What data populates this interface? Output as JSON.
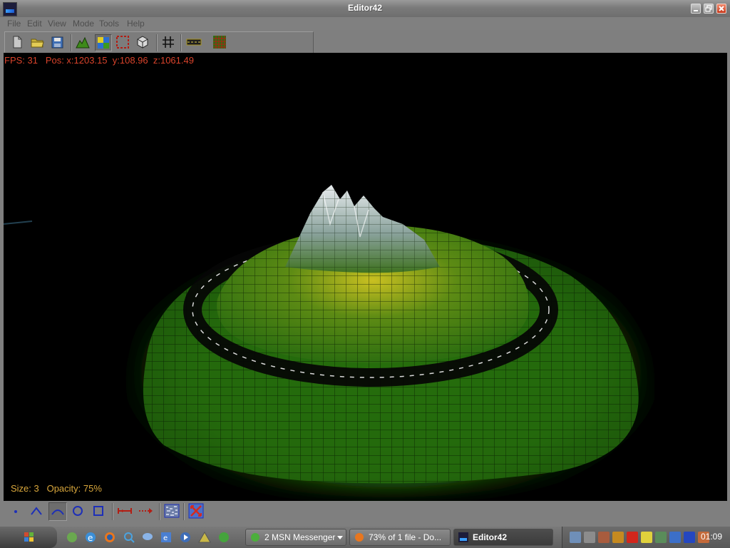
{
  "window": {
    "title": "Editor42",
    "icon": "editor42-app-icon"
  },
  "menu": [
    "File",
    "Edit",
    "View",
    "Mode",
    "Tools",
    "Help"
  ],
  "toolbar": {
    "buttons": [
      {
        "name": "new-file-icon"
      },
      {
        "name": "open-folder-icon"
      },
      {
        "name": "save-disk-icon"
      },
      {
        "name": "terrain-heightmap-icon"
      },
      {
        "name": "texture-paint-icon"
      },
      {
        "name": "selection-area-icon"
      },
      {
        "name": "cube-object-icon"
      },
      {
        "name": "grid-toggle-icon"
      },
      {
        "name": "road-tool-icon"
      },
      {
        "name": "tile-grid-icon"
      }
    ]
  },
  "viewport": {
    "fps_label": "FPS: 31",
    "pos_label": "Pos: x:1203.15  y:108.96  z:1061.49",
    "size_label": "Size: 3",
    "opacity_label": "Opacity: 75%"
  },
  "bottom_toolbar": {
    "buttons": [
      {
        "name": "point-brush-icon"
      },
      {
        "name": "peak-brush-icon"
      },
      {
        "name": "smooth-brush-icon"
      },
      {
        "name": "circle-brush-icon"
      },
      {
        "name": "square-brush-icon"
      },
      {
        "name": "measure-distance-icon"
      },
      {
        "name": "dotted-arrow-icon"
      },
      {
        "name": "noise-texture-icon"
      },
      {
        "name": "fit-view-icon"
      }
    ]
  },
  "taskbar": {
    "tasks": [
      {
        "label": "2 MSN Messenger",
        "icon": "msn-messenger-icon",
        "active": false
      },
      {
        "label": "73% of 1 file - Do...",
        "icon": "firefox-download-icon",
        "active": false
      },
      {
        "label": "Editor42",
        "icon": "editor42-app-icon",
        "active": true
      }
    ],
    "clock": "01:09"
  },
  "colors": {
    "hud_red": "#d9432b",
    "brush_amber": "#d9a73c",
    "terrain_green": "#2f7d12",
    "terrain_yellow": "#c9c021"
  }
}
